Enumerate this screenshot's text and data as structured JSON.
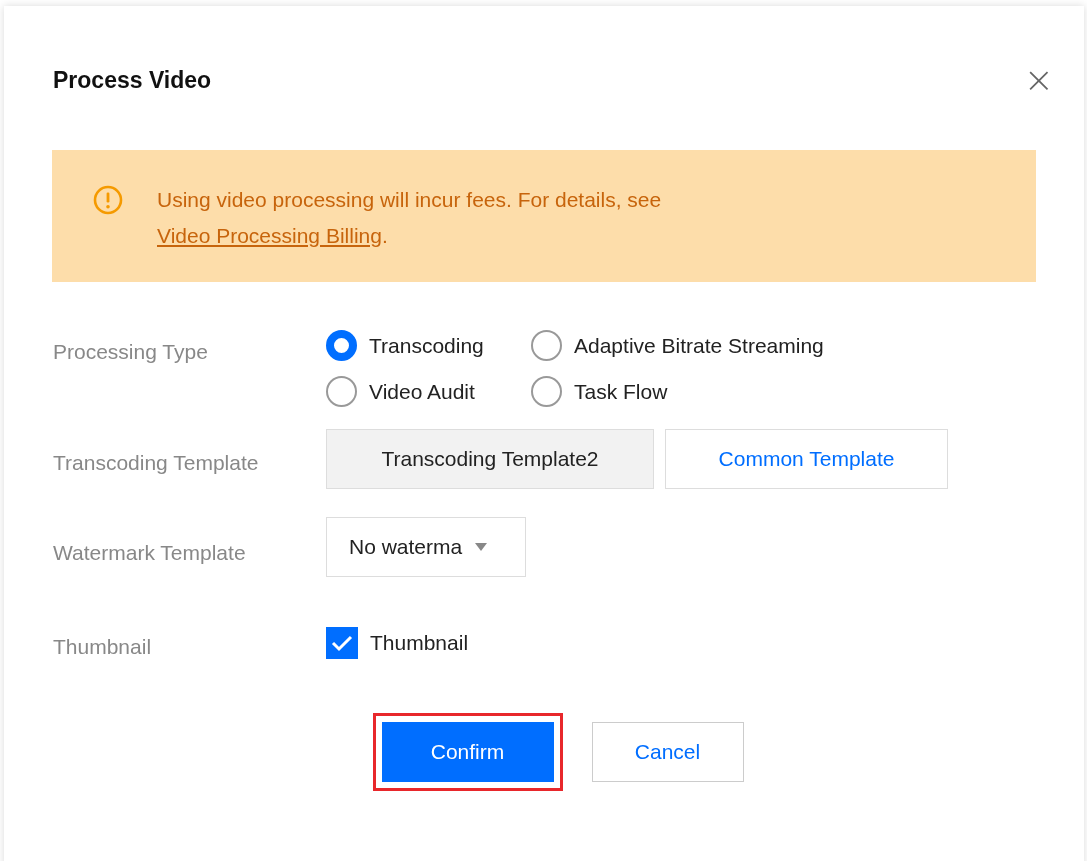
{
  "dialog": {
    "title": "Process Video",
    "close": "×"
  },
  "notice": {
    "text": "Using video processing will incur fees. For details, see ",
    "link": "Video Processing Billing",
    "after": "."
  },
  "fields": [
    {
      "kind": "radio",
      "label": "Processing Type",
      "options": [
        {
          "label": "Transcoding",
          "selected": true
        },
        {
          "label": "Adaptive Bitrate Streaming",
          "selected": false
        },
        {
          "label": "Video Audit",
          "selected": false
        },
        {
          "label": "Task Flow",
          "selected": false
        }
      ]
    },
    {
      "kind": "template",
      "label": "Transcoding Template",
      "value": "Transcoding Template2",
      "action": "Common Template"
    },
    {
      "kind": "select",
      "label": "Watermark Template",
      "value": "No waterma"
    },
    {
      "kind": "checkbox",
      "label": "Thumbnail",
      "option": "Thumbnail",
      "checked": true
    }
  ],
  "buttons": [
    {
      "label": "Confirm",
      "primary": true,
      "highlighted": true
    },
    {
      "label": "Cancel",
      "primary": false,
      "highlighted": false
    }
  ]
}
